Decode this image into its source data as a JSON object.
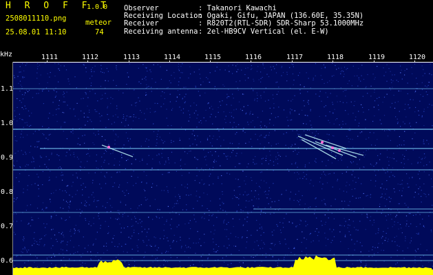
{
  "header": {
    "app_name": "H R O F F T",
    "version": "1.0.0",
    "filename": "2508011110.png",
    "datetime": "25.08.01 11:10",
    "meteor_label": "meteor",
    "meteor_count": "74",
    "observer_label": "Observer",
    "observer_value": ": Takanori Kawachi",
    "location_label": "Receiving Location",
    "location_value": ": Ogaki, Gifu, JAPAN (136.60E, 35.35N)",
    "receiver_label": "Receiver",
    "receiver_value": ": R820T2(RTL-SDR) SDR-Sharp 53.1000MHz",
    "antenna_label": "Receiving antenna",
    "antenna_value": ": 2el-HB9CV Vertical (el. E-W)"
  },
  "axis": {
    "y_unit": "kHz",
    "x_ticks": [
      "1111",
      "1112",
      "1113",
      "1114",
      "1115",
      "1116",
      "1117",
      "1118",
      "1119",
      "1120"
    ],
    "y_ticks": [
      "1.1",
      "1.0",
      "0.9",
      "0.8",
      "0.7",
      "0.6"
    ]
  },
  "colors": {
    "background": "#000a5a",
    "noise": "#2a48c8",
    "trace": "#7fd8ff",
    "meteor": "#ff6ad5",
    "noise_floor": "#ffff00"
  }
}
